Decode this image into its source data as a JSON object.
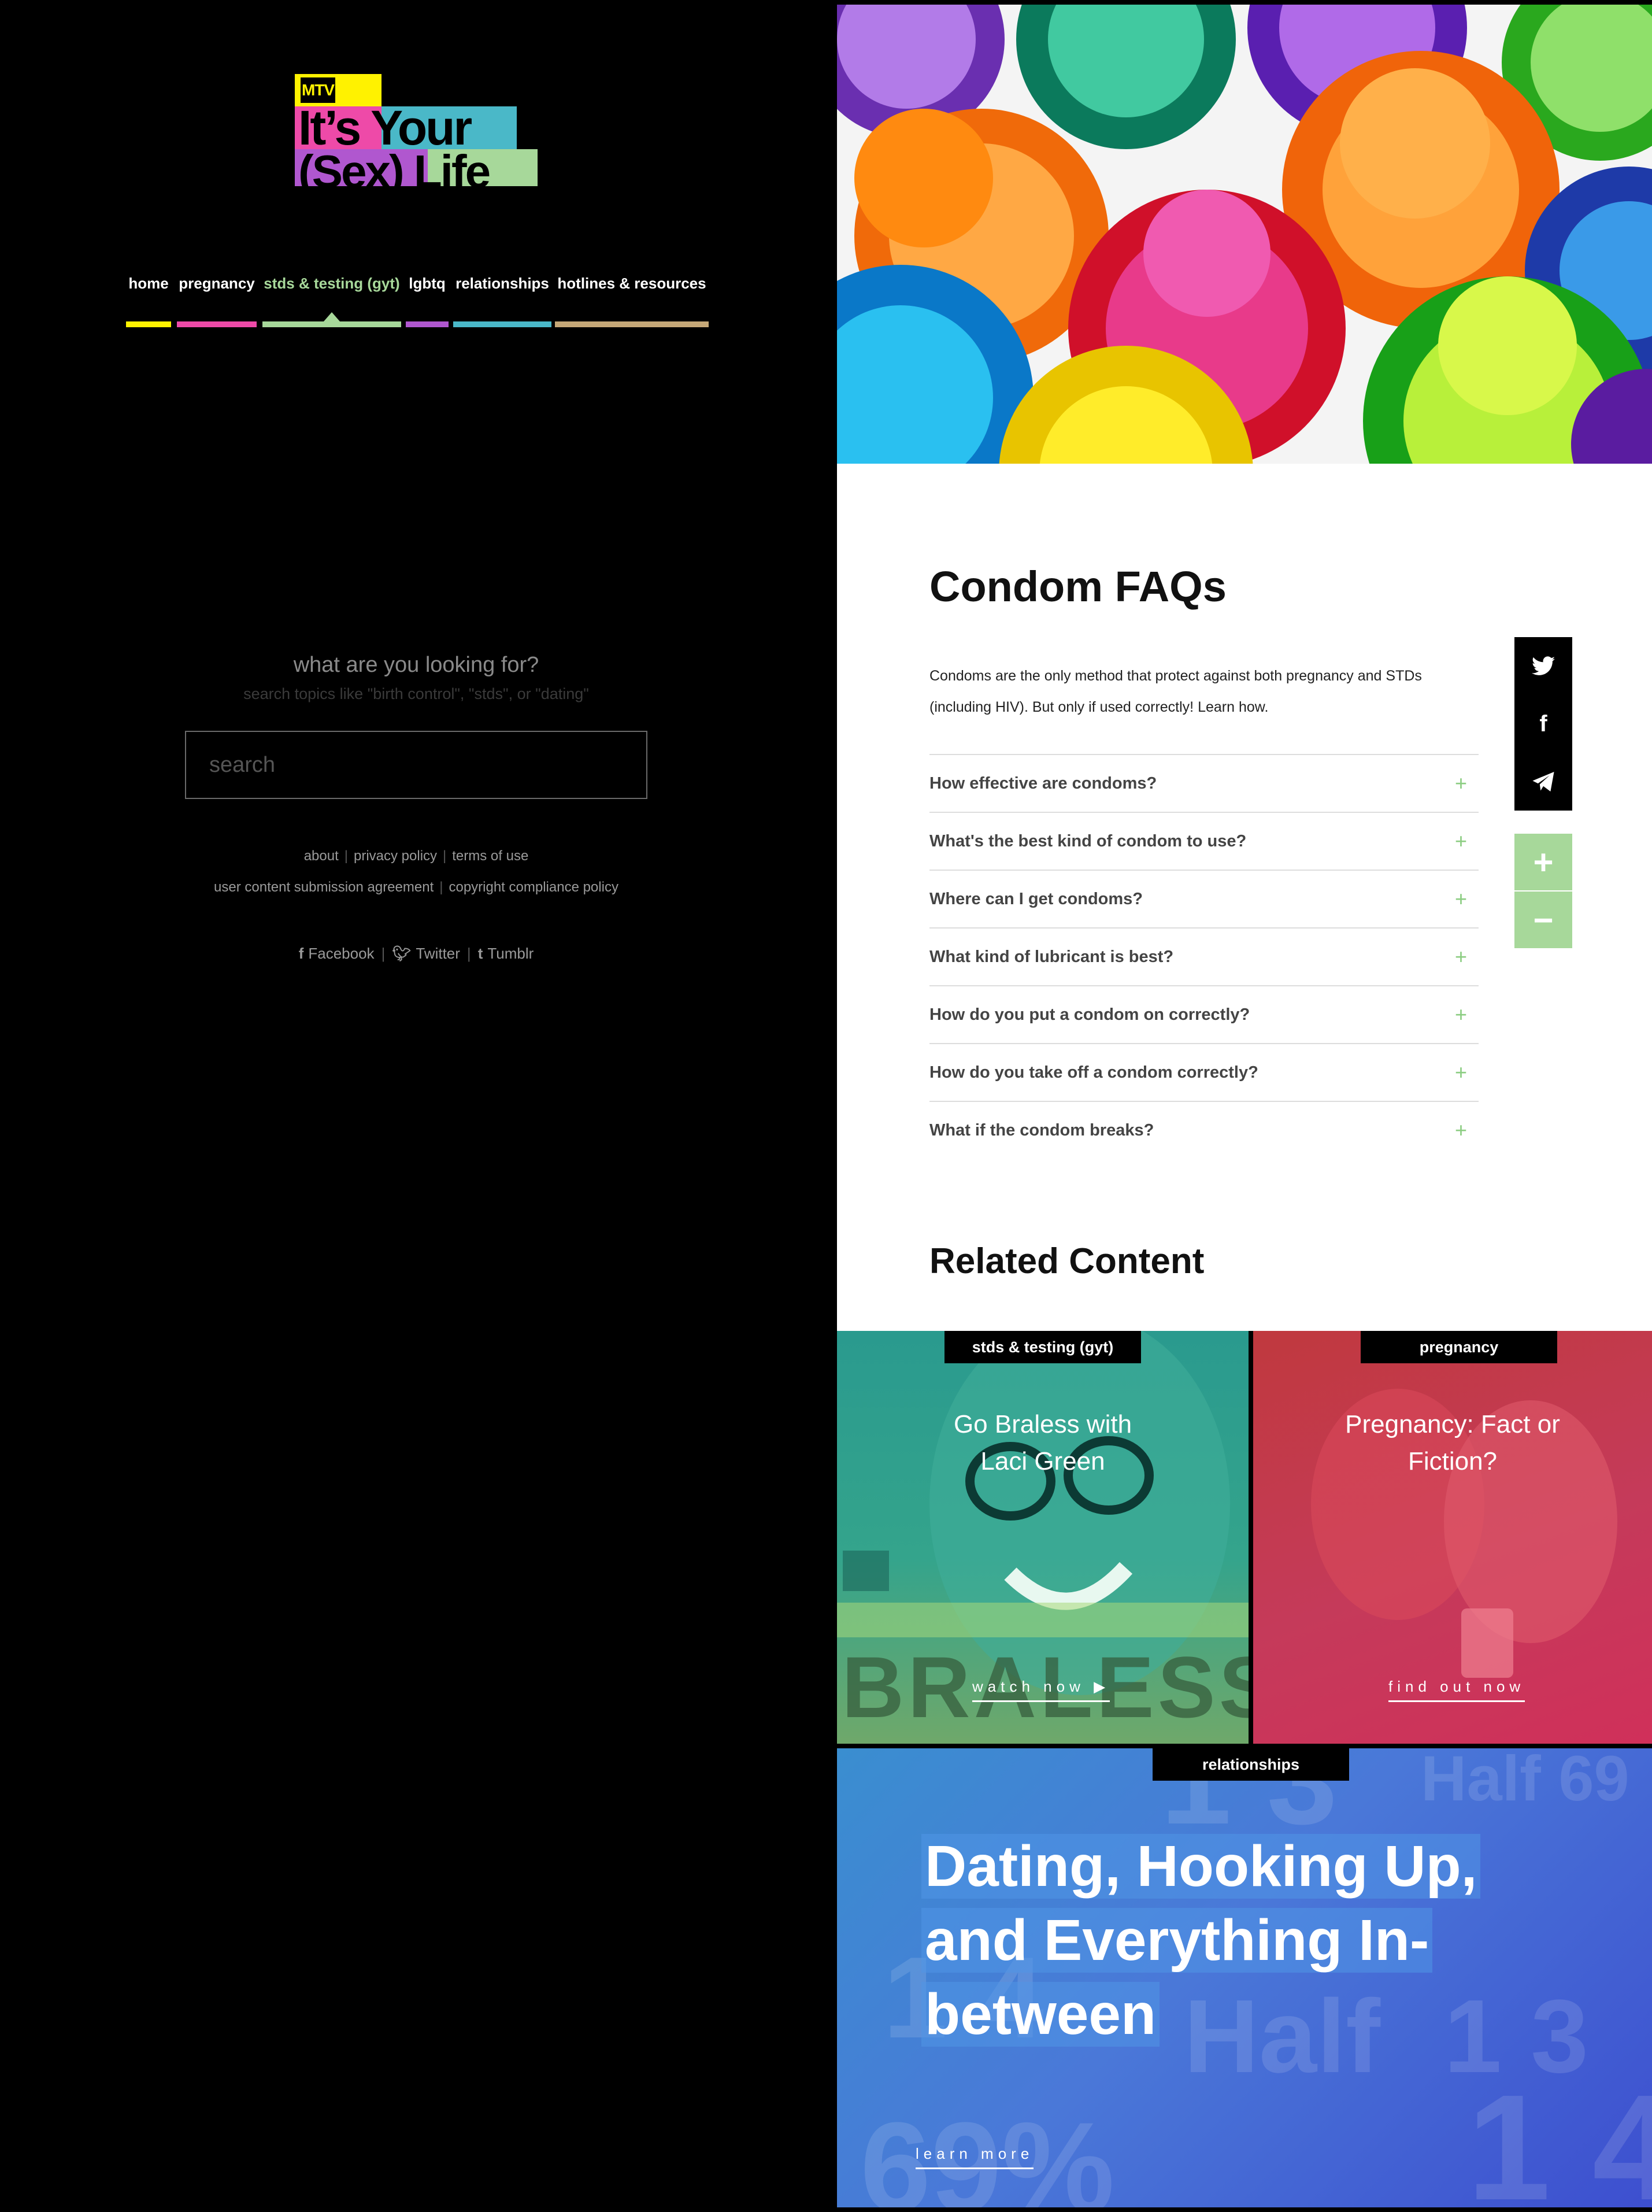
{
  "logo": {
    "badge": "MTV",
    "line1": "It’s Your",
    "line2": "(Sex) Life"
  },
  "nav": {
    "items": [
      {
        "label": "home",
        "color": "#fff200"
      },
      {
        "label": "pregnancy",
        "color": "#ee4aa8"
      },
      {
        "label": "stds & testing (gyt)",
        "color": "#a7d89a",
        "active": true
      },
      {
        "label": "lgbtq",
        "color": "#b057cf"
      },
      {
        "label": "relationships",
        "color": "#4ab8c8"
      },
      {
        "label": "hotlines & resources",
        "color": "#c5a878"
      }
    ]
  },
  "search": {
    "question": "what are you looking for?",
    "hint": "search topics like \"birth control\", \"stds\", or \"dating\"",
    "placeholder": "search"
  },
  "footer": {
    "links_row1": [
      "about",
      "privacy policy",
      "terms of use"
    ],
    "links_row2": [
      "user content submission agreement",
      "copyright compliance policy"
    ],
    "social": [
      {
        "icon": "facebook-icon",
        "label": "Facebook"
      },
      {
        "icon": "twitter-icon",
        "label": "Twitter"
      },
      {
        "icon": "tumblr-icon",
        "label": "Tumblr"
      }
    ]
  },
  "article": {
    "title": "Condom FAQs",
    "intro": "Condoms are the only method that protect against both pregnancy and STDs (including HIV). But only if used correctly! Learn how.",
    "faqs": [
      "How effective are condoms?",
      "What's the best kind of condom to use?",
      "Where can I get condoms?",
      "What kind of lubricant is best?",
      "How do you put a condom on correctly?",
      "How do you take off a condom correctly?",
      "What if the condom breaks?"
    ],
    "share_icons": [
      "twitter-icon",
      "facebook-icon",
      "telegram-icon"
    ],
    "zoom": {
      "in": "+",
      "out": "−"
    }
  },
  "related": {
    "title": "Related Content",
    "cards": [
      {
        "tag": "stds & testing (gyt)",
        "title_line1": "Go Braless with",
        "title_line2": "Laci Green",
        "cta": "watch now ▶",
        "overlay_text": "BRALESS"
      },
      {
        "tag": "pregnancy",
        "title_line1": "Pregnancy: Fact or",
        "title_line2": "Fiction?",
        "cta": "find out now"
      },
      {
        "tag": "relationships",
        "title_line1": "Dating, Hooking Up,",
        "title_line2": "and Everything In-",
        "title_line3": "between",
        "cta": "learn more"
      }
    ]
  },
  "colors": {
    "accent_green": "#a7d89a",
    "nav_yellow": "#fff200",
    "nav_pink": "#ee4aa8",
    "nav_purple": "#b057cf",
    "nav_teal": "#4ab8c8",
    "nav_tan": "#c5a878"
  }
}
